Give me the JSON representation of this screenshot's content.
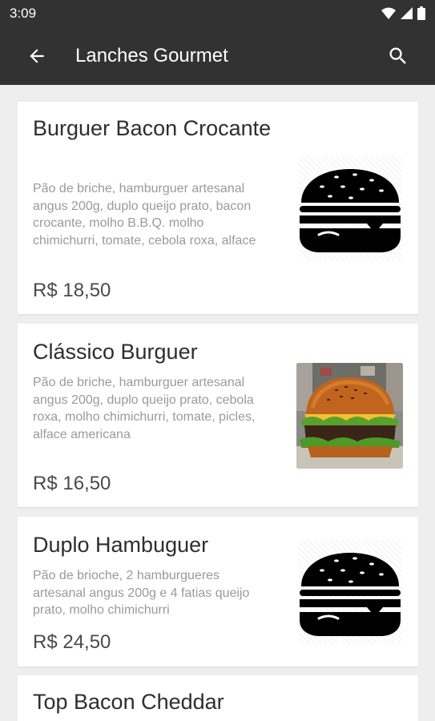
{
  "status_bar": {
    "time": "3:09"
  },
  "app_bar": {
    "title": "Lanches Gourmet"
  },
  "items": [
    {
      "name": "Burguer Bacon Crocante",
      "description": "Pão de briche, hamburguer artesanal angus 200g, duplo queijo prato, bacon crocante, molho B.B.Q. molho chimichurri, tomate, cebola roxa, alface",
      "price": "R$ 18,50",
      "image": "burger-icon"
    },
    {
      "name": "Clássico Burguer",
      "description": "Pão de briche, hamburguer artesanal angus 200g, duplo queijo prato, cebola roxa, molho chimichurri, tomate, picles, alface americana",
      "price": "R$ 16,50",
      "image": "burger-photo"
    },
    {
      "name": "Duplo Hambuguer",
      "description": "Pão de brioche, 2 hamburgueres artesanal angus 200g e 4 fatias queijo prato, molho chimichurri",
      "price": "R$ 24,50",
      "image": "burger-icon"
    },
    {
      "name": "Top Bacon Cheddar"
    }
  ],
  "colors": {
    "app_bar": "#323232",
    "background": "#eeeeee",
    "card": "#ffffff"
  }
}
